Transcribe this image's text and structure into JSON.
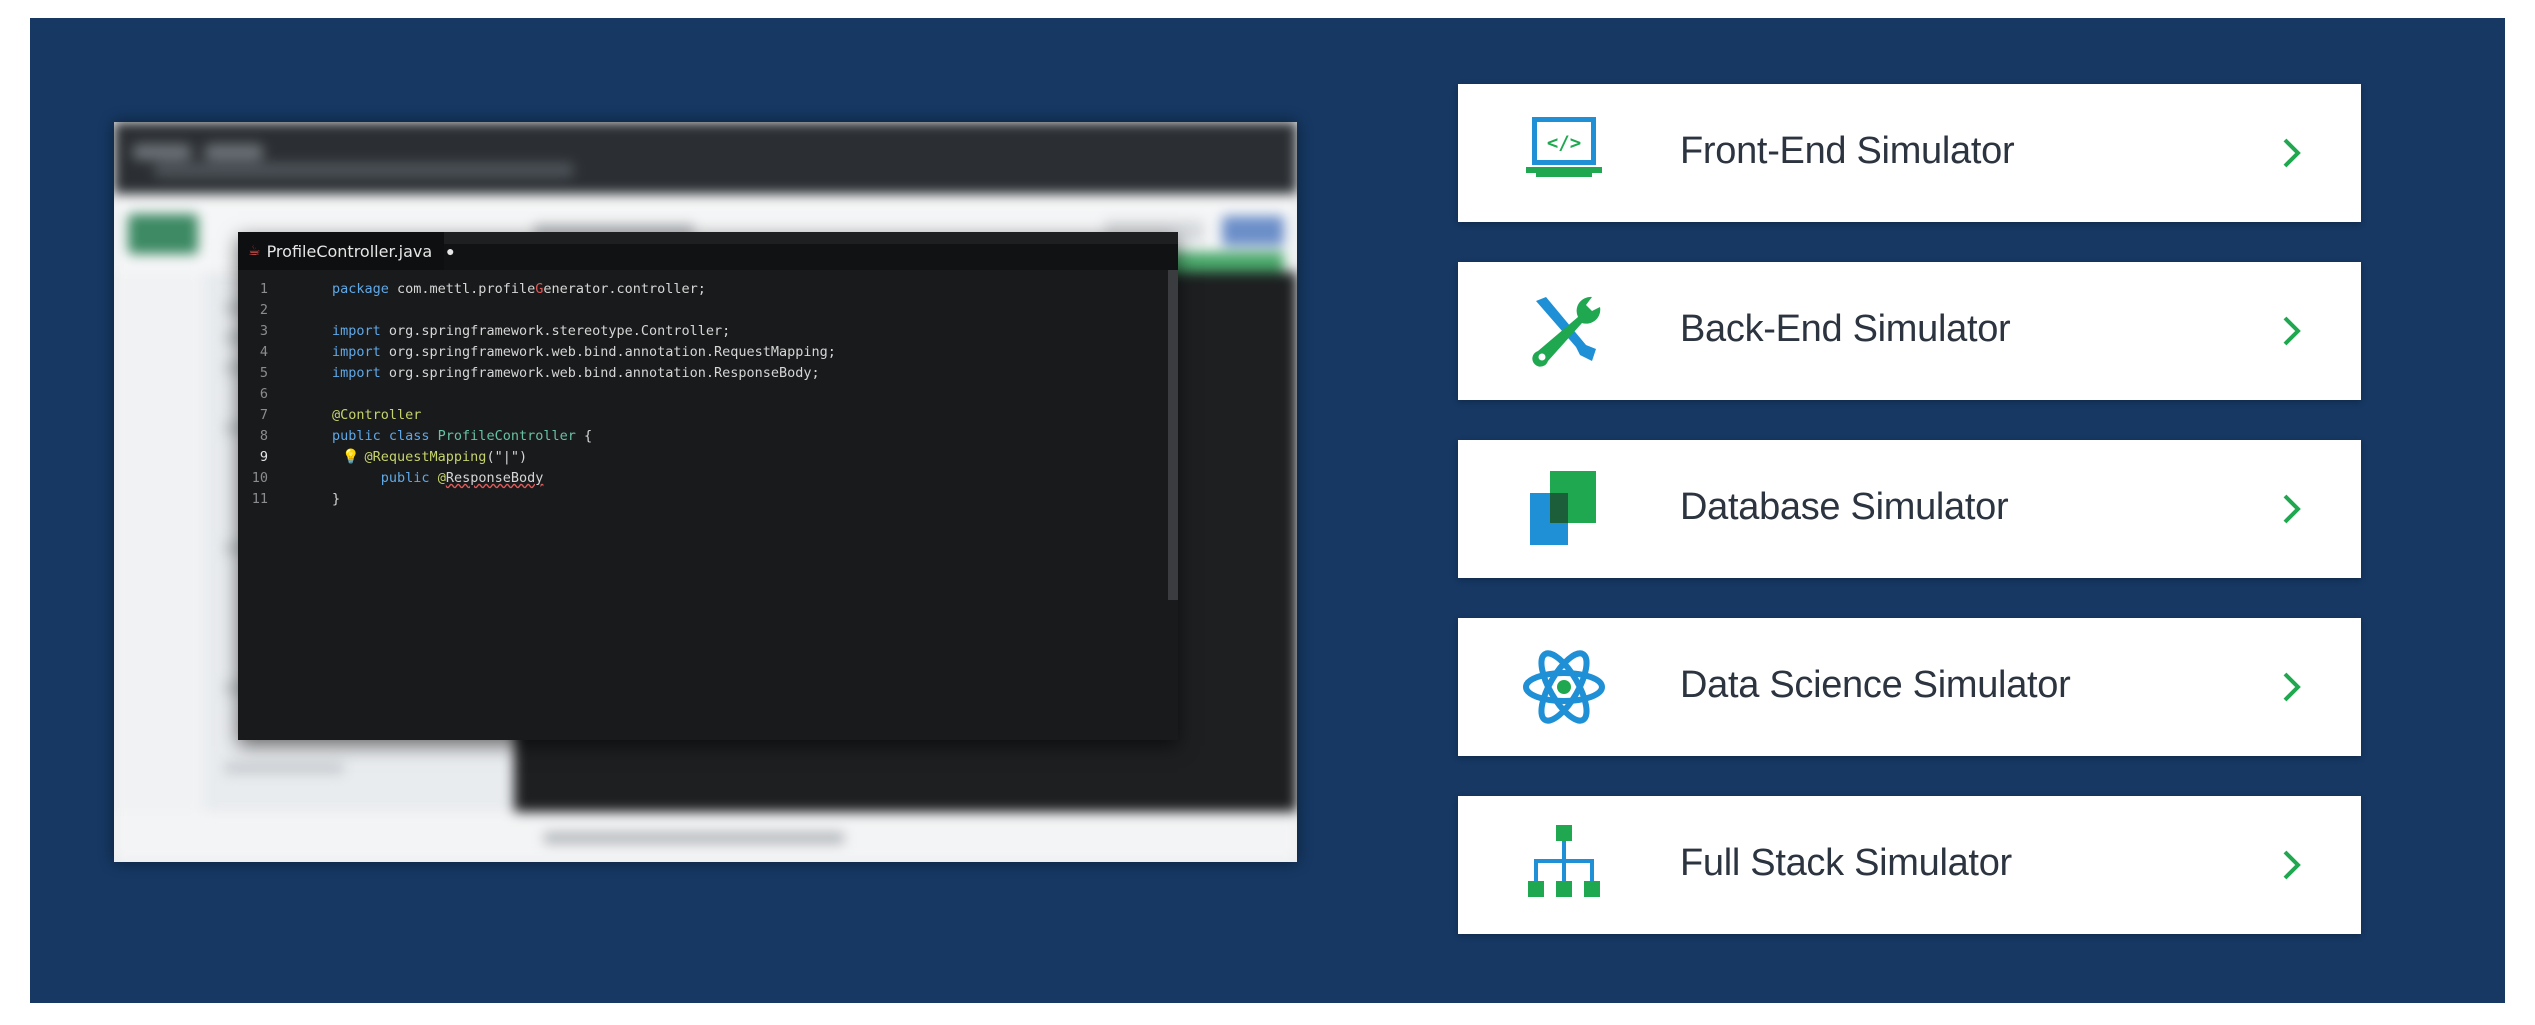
{
  "editor": {
    "tab_name": "ProfileController.java",
    "tab_dot": "●",
    "lines": [
      {
        "n": "1",
        "parts": [
          [
            "kw",
            "package"
          ],
          [
            "",
            " com.mettl.profile"
          ],
          [
            "err-red",
            "G"
          ],
          [
            "",
            "enerator.controller;"
          ]
        ]
      },
      {
        "n": "2",
        "parts": []
      },
      {
        "n": "3",
        "parts": [
          [
            "kw",
            "import"
          ],
          [
            "",
            " org.springframework.stereotype.Controller;"
          ]
        ]
      },
      {
        "n": "4",
        "parts": [
          [
            "kw",
            "import"
          ],
          [
            "",
            " org.springframework.web.bind.annotation.RequestMapping;"
          ]
        ]
      },
      {
        "n": "5",
        "parts": [
          [
            "kw",
            "import"
          ],
          [
            "",
            " org.springframework.web.bind.annotation.ResponseBody;"
          ]
        ]
      },
      {
        "n": "6",
        "parts": []
      },
      {
        "n": "7",
        "parts": [
          [
            "ann",
            "@Controller"
          ]
        ]
      },
      {
        "n": "8",
        "parts": [
          [
            "kw",
            "public class "
          ],
          [
            "typ",
            "ProfileController"
          ],
          [
            "",
            " {"
          ]
        ]
      },
      {
        "n": "9",
        "parts": [
          [
            "",
            "    "
          ],
          [
            "ann",
            "@RequestMapping"
          ],
          [
            "",
            "(\"|\")"
          ]
        ]
      },
      {
        "n": "10",
        "parts": [
          [
            "",
            "      "
          ],
          [
            "kw",
            "public "
          ],
          [
            "ann",
            "@"
          ],
          [
            "err",
            "ResponseBody"
          ]
        ]
      },
      {
        "n": "11",
        "parts": [
          [
            "",
            "}"
          ]
        ]
      }
    ]
  },
  "simulators": [
    {
      "label": "Front-End Simulator",
      "icon": "laptop-code-icon"
    },
    {
      "label": "Back-End Simulator",
      "icon": "tools-icon"
    },
    {
      "label": "Database Simulator",
      "icon": "database-squares-icon"
    },
    {
      "label": "Data Science Simulator",
      "icon": "atom-icon"
    },
    {
      "label": "Full Stack Simulator",
      "icon": "hierarchy-icon"
    }
  ],
  "colors": {
    "panel_bg": "#163863",
    "accent_green": "#1fa84f",
    "accent_blue": "#1f8fd6",
    "card_text": "#2c3440"
  }
}
